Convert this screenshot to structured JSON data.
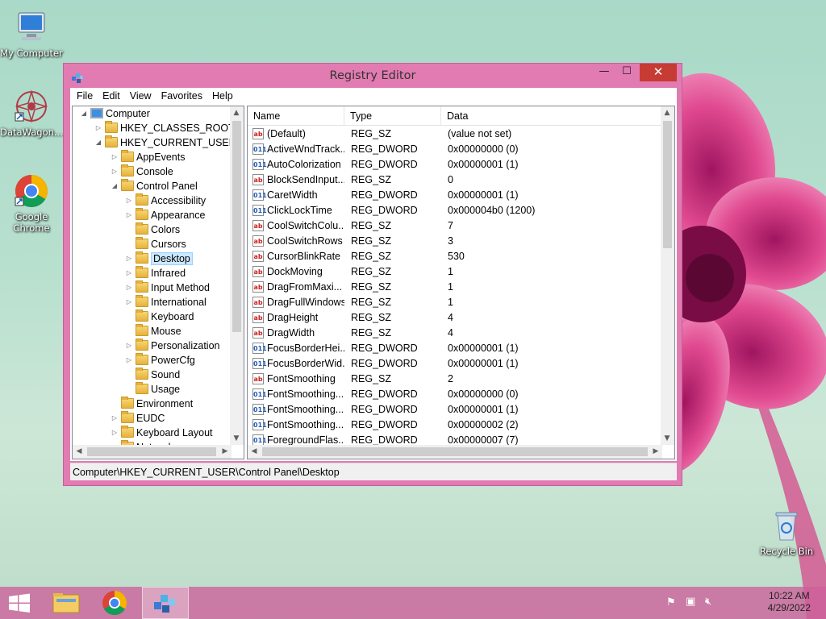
{
  "desktop": {
    "icons": [
      {
        "label": "My Computer"
      },
      {
        "label": "DataWagon..."
      },
      {
        "label": "Google Chrome"
      },
      {
        "label": "Recycle Bin"
      }
    ]
  },
  "window": {
    "title": "Registry Editor",
    "controls": {
      "minimize": "—",
      "maximize": "☐",
      "close": "✕"
    },
    "menu": [
      "File",
      "Edit",
      "View",
      "Favorites",
      "Help"
    ],
    "tree": [
      {
        "label": "Computer",
        "level": 0,
        "arrow": "◢"
      },
      {
        "label": "HKEY_CLASSES_ROOT",
        "level": 1,
        "arrow": "▷"
      },
      {
        "label": "HKEY_CURRENT_USER",
        "level": 1,
        "arrow": "◢"
      },
      {
        "label": "AppEvents",
        "level": 2,
        "arrow": "▷"
      },
      {
        "label": "Console",
        "level": 2,
        "arrow": "▷"
      },
      {
        "label": "Control Panel",
        "level": 2,
        "arrow": "◢"
      },
      {
        "label": "Accessibility",
        "level": 3,
        "arrow": "▷"
      },
      {
        "label": "Appearance",
        "level": 3,
        "arrow": "▷"
      },
      {
        "label": "Colors",
        "level": 3,
        "arrow": ""
      },
      {
        "label": "Cursors",
        "level": 3,
        "arrow": ""
      },
      {
        "label": "Desktop",
        "level": 3,
        "arrow": "▷",
        "selected": true
      },
      {
        "label": "Infrared",
        "level": 3,
        "arrow": "▷"
      },
      {
        "label": "Input Method",
        "level": 3,
        "arrow": "▷"
      },
      {
        "label": "International",
        "level": 3,
        "arrow": "▷"
      },
      {
        "label": "Keyboard",
        "level": 3,
        "arrow": ""
      },
      {
        "label": "Mouse",
        "level": 3,
        "arrow": ""
      },
      {
        "label": "Personalization",
        "level": 3,
        "arrow": "▷"
      },
      {
        "label": "PowerCfg",
        "level": 3,
        "arrow": "▷"
      },
      {
        "label": "Sound",
        "level": 3,
        "arrow": ""
      },
      {
        "label": "Usage",
        "level": 3,
        "arrow": ""
      },
      {
        "label": "Environment",
        "level": 2,
        "arrow": ""
      },
      {
        "label": "EUDC",
        "level": 2,
        "arrow": "▷"
      },
      {
        "label": "Keyboard Layout",
        "level": 2,
        "arrow": "▷"
      },
      {
        "label": "Network",
        "level": 2,
        "arrow": ""
      }
    ],
    "columns": {
      "name": "Name",
      "type": "Type",
      "data": "Data"
    },
    "values": [
      {
        "name": "(Default)",
        "type": "REG_SZ",
        "data": "(value not set)",
        "icon": "ab"
      },
      {
        "name": "ActiveWndTrack...",
        "type": "REG_DWORD",
        "data": "0x00000000 (0)",
        "icon": "dw"
      },
      {
        "name": "AutoColorization",
        "type": "REG_DWORD",
        "data": "0x00000001 (1)",
        "icon": "dw"
      },
      {
        "name": "BlockSendInput...",
        "type": "REG_SZ",
        "data": "0",
        "icon": "ab"
      },
      {
        "name": "CaretWidth",
        "type": "REG_DWORD",
        "data": "0x00000001 (1)",
        "icon": "dw"
      },
      {
        "name": "ClickLockTime",
        "type": "REG_DWORD",
        "data": "0x000004b0 (1200)",
        "icon": "dw"
      },
      {
        "name": "CoolSwitchColu...",
        "type": "REG_SZ",
        "data": "7",
        "icon": "ab"
      },
      {
        "name": "CoolSwitchRows",
        "type": "REG_SZ",
        "data": "3",
        "icon": "ab"
      },
      {
        "name": "CursorBlinkRate",
        "type": "REG_SZ",
        "data": "530",
        "icon": "ab"
      },
      {
        "name": "DockMoving",
        "type": "REG_SZ",
        "data": "1",
        "icon": "ab"
      },
      {
        "name": "DragFromMaxi...",
        "type": "REG_SZ",
        "data": "1",
        "icon": "ab"
      },
      {
        "name": "DragFullWindows",
        "type": "REG_SZ",
        "data": "1",
        "icon": "ab"
      },
      {
        "name": "DragHeight",
        "type": "REG_SZ",
        "data": "4",
        "icon": "ab"
      },
      {
        "name": "DragWidth",
        "type": "REG_SZ",
        "data": "4",
        "icon": "ab"
      },
      {
        "name": "FocusBorderHei...",
        "type": "REG_DWORD",
        "data": "0x00000001 (1)",
        "icon": "dw"
      },
      {
        "name": "FocusBorderWid...",
        "type": "REG_DWORD",
        "data": "0x00000001 (1)",
        "icon": "dw"
      },
      {
        "name": "FontSmoothing",
        "type": "REG_SZ",
        "data": "2",
        "icon": "ab"
      },
      {
        "name": "FontSmoothing...",
        "type": "REG_DWORD",
        "data": "0x00000000 (0)",
        "icon": "dw"
      },
      {
        "name": "FontSmoothing...",
        "type": "REG_DWORD",
        "data": "0x00000001 (1)",
        "icon": "dw"
      },
      {
        "name": "FontSmoothing...",
        "type": "REG_DWORD",
        "data": "0x00000002 (2)",
        "icon": "dw"
      },
      {
        "name": "ForegroundFlas...",
        "type": "REG_DWORD",
        "data": "0x00000007 (7)",
        "icon": "dw"
      }
    ],
    "status_path": "Computer\\HKEY_CURRENT_USER\\Control Panel\\Desktop"
  },
  "taskbar": {
    "clock_time": "10:22 AM",
    "clock_date": "4/29/2022"
  },
  "colors": {
    "window_frame": "#e17bb2",
    "close_button": "#c73b35",
    "selection": "#cce8ff",
    "taskbar": "#cd5f9b"
  }
}
